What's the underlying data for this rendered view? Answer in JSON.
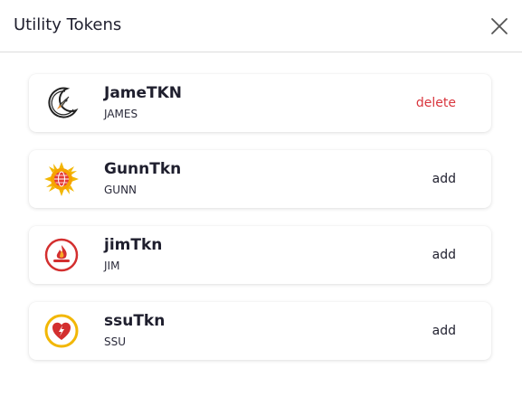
{
  "modal": {
    "title": "Utility Tokens"
  },
  "tokens": [
    {
      "name": "JameTKN",
      "symbol": "JAMES",
      "action": "delete",
      "icon": "crescent-rocket-icon"
    },
    {
      "name": "GunnTkn",
      "symbol": "GUNN",
      "action": "add",
      "icon": "sun-globe-icon"
    },
    {
      "name": "jimTkn",
      "symbol": "JIM",
      "action": "add",
      "icon": "campfire-icon"
    },
    {
      "name": "ssuTkn",
      "symbol": "SSU",
      "action": "add",
      "icon": "heart-bolt-icon"
    }
  ],
  "colors": {
    "delete": "#d9363e",
    "text": "#1f1f2e",
    "divider": "#dcdcdc"
  }
}
